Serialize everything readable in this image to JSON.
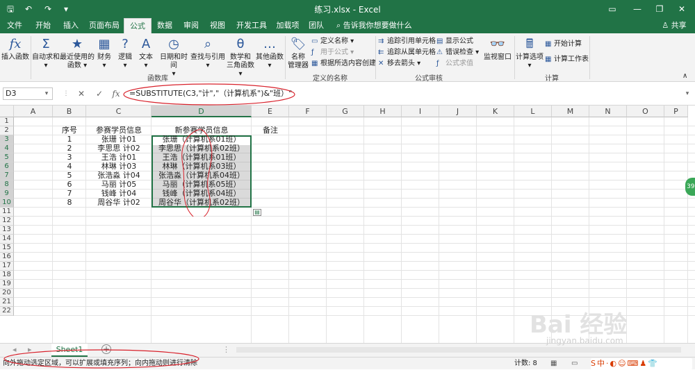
{
  "titlebar": {
    "title": "练习.xlsx  -  Excel",
    "quick_access": [
      "save-icon",
      "undo-icon",
      "redo-icon",
      "customize-icon"
    ],
    "controls": [
      "ribbon-display-icon",
      "minimize-icon",
      "restore-icon",
      "close-icon"
    ]
  },
  "tabs": [
    "文件",
    "开始",
    "插入",
    "页面布局",
    "公式",
    "数据",
    "审阅",
    "视图",
    "开发工具",
    "加载项",
    "团队"
  ],
  "active_tab": "公式",
  "tell_me": "告诉我你想要做什么",
  "share": "共享",
  "ribbon": {
    "insert_function": {
      "icon": "fx",
      "label": "插入函数"
    },
    "library": [
      {
        "icon": "Σ",
        "label": "自动求和",
        "sub": "▾"
      },
      {
        "icon": "★",
        "label": "最近使用的",
        "sub": "函数 ▾"
      },
      {
        "icon": "▦",
        "label": "财务",
        "sub": "▾"
      },
      {
        "icon": "?",
        "label": "逻辑",
        "sub": "▾"
      },
      {
        "icon": "A",
        "label": "文本",
        "sub": "▾"
      },
      {
        "icon": "◷",
        "label": "日期和时间",
        "sub": "▾"
      },
      {
        "icon": "⌕",
        "label": "查找与引用",
        "sub": "▾"
      },
      {
        "icon": "θ",
        "label": "数学和",
        "sub": "三角函数 ▾"
      },
      {
        "icon": "…",
        "label": "其他函数",
        "sub": "▾"
      }
    ],
    "library_group": "函数库",
    "name_manager": {
      "label": "名称",
      "sub": "管理器"
    },
    "defined_names": [
      "定义名称 ▾",
      "用于公式 ▾",
      "根据所选内容创建"
    ],
    "defined_group": "定义的名称",
    "auditing": [
      "追踪引用单元格",
      "追踪从属单元格",
      "移去箭头 ▾",
      "显示公式",
      "错误检查 ▾",
      "公式求值"
    ],
    "auditing_group": "公式审核",
    "watch": {
      "label": "监视窗口"
    },
    "calc_options": {
      "label": "计算选项",
      "sub": "▾"
    },
    "calc_small": [
      "开始计算",
      "计算工作表"
    ],
    "calc_group": "计算"
  },
  "formula_bar": {
    "namebox": "D3",
    "cancel": "✕",
    "enter": "✓",
    "fx": "fx",
    "formula": "=SUBSTITUTE(C3,\"计\",\"（计算机系\")&\"班）\""
  },
  "columns": [
    "A",
    "B",
    "C",
    "D",
    "E",
    "F",
    "G",
    "H",
    "I",
    "J",
    "K",
    "L",
    "M",
    "N",
    "O",
    "P"
  ],
  "selected_column": "D",
  "rows": [
    "1",
    "2",
    "3",
    "4",
    "5",
    "6",
    "7",
    "8",
    "9",
    "10",
    "11",
    "12",
    "13",
    "14",
    "15",
    "16",
    "17",
    "18",
    "19",
    "20",
    "21",
    "22"
  ],
  "headers": {
    "seq": "序号",
    "info": "参赛学员信息",
    "new_info": "新参赛学员信息",
    "note": "备注"
  },
  "table": [
    {
      "seq": "1",
      "info": "张珊 计01",
      "new": "张珊（计算机系01班）"
    },
    {
      "seq": "2",
      "info": "李思思 计02",
      "new": "李思思（计算机系02班）"
    },
    {
      "seq": "3",
      "info": "王浩 计01",
      "new": "王浩（计算机系01班）"
    },
    {
      "seq": "4",
      "info": "林琳 计03",
      "new": "林琳（计算机系03班）"
    },
    {
      "seq": "5",
      "info": "张浩淼 计04",
      "new": "张浩淼（计算机系04班）"
    },
    {
      "seq": "6",
      "info": "马丽 计05",
      "new": "马丽（计算机系05班）"
    },
    {
      "seq": "7",
      "info": "钱峰 计04",
      "new": "钱峰（计算机系04班）"
    },
    {
      "seq": "8",
      "info": "周谷华 计02",
      "new": "周谷华（计算机系02班）"
    }
  ],
  "sheet_tab": "Sheet1",
  "status": {
    "message": "向外拖动选定区域，可以扩展或填充序列；向内拖动则进行清除",
    "count": "计数: 8"
  },
  "watermark": {
    "text": "Bai  经验",
    "url": "jingyan.baidu.com"
  },
  "side_badge": "39"
}
